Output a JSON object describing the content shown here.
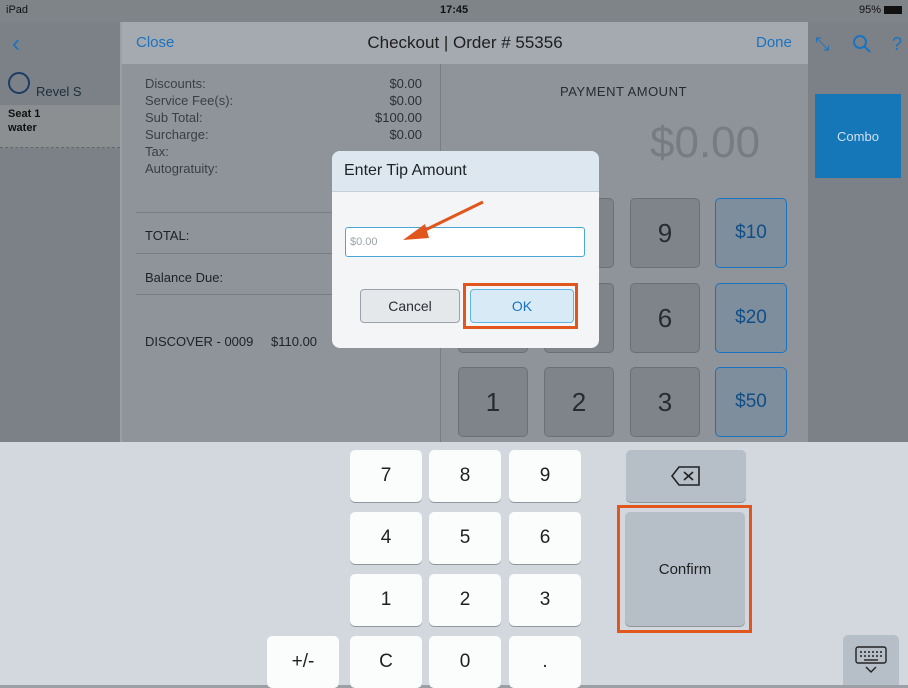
{
  "status": {
    "device": "iPad",
    "time": "17:45",
    "battery": "95%"
  },
  "sidebar": {
    "user": "Revel S",
    "seat": "Seat 1",
    "item": "water"
  },
  "toolbar": {
    "combo": "Combo"
  },
  "checkout": {
    "close": "Close",
    "title": "Checkout | Order # 55356",
    "done": "Done",
    "summary": [
      {
        "label": "Discounts:",
        "value": "$0.00"
      },
      {
        "label": "Service Fee(s):",
        "value": "$0.00"
      },
      {
        "label": "Sub Total:",
        "value": "$100.00"
      },
      {
        "label": "Surcharge:",
        "value": "$0.00"
      },
      {
        "label": "Tax:",
        "value": ""
      },
      {
        "label": "Autogratuity:",
        "value": ""
      }
    ],
    "total_label": "TOTAL:",
    "balance_label": "Balance Due:",
    "payment": {
      "card": "DISCOVER - 0009",
      "amount": "$110.00"
    },
    "payment_amount_title": "PAYMENT AMOUNT",
    "payment_amount": "$0.00",
    "keypad": {
      "k9": "9",
      "k6": "6",
      "k1": "1",
      "k2": "2",
      "k3": "3"
    },
    "quick": {
      "q10": "$10",
      "q20": "$20",
      "q50": "$50"
    }
  },
  "dialog": {
    "title": "Enter Tip Amount",
    "placeholder": "$0.00",
    "cancel": "Cancel",
    "ok": "OK"
  },
  "keyboard": {
    "r1": [
      "7",
      "8",
      "9"
    ],
    "r2": [
      "4",
      "5",
      "6"
    ],
    "r3": [
      "1",
      "2",
      "3"
    ],
    "r4": [
      "+/-",
      "C",
      "0",
      "."
    ],
    "confirm": "Confirm"
  },
  "colors": {
    "accent": "#1a73c0",
    "highlight": "#e0561d"
  }
}
